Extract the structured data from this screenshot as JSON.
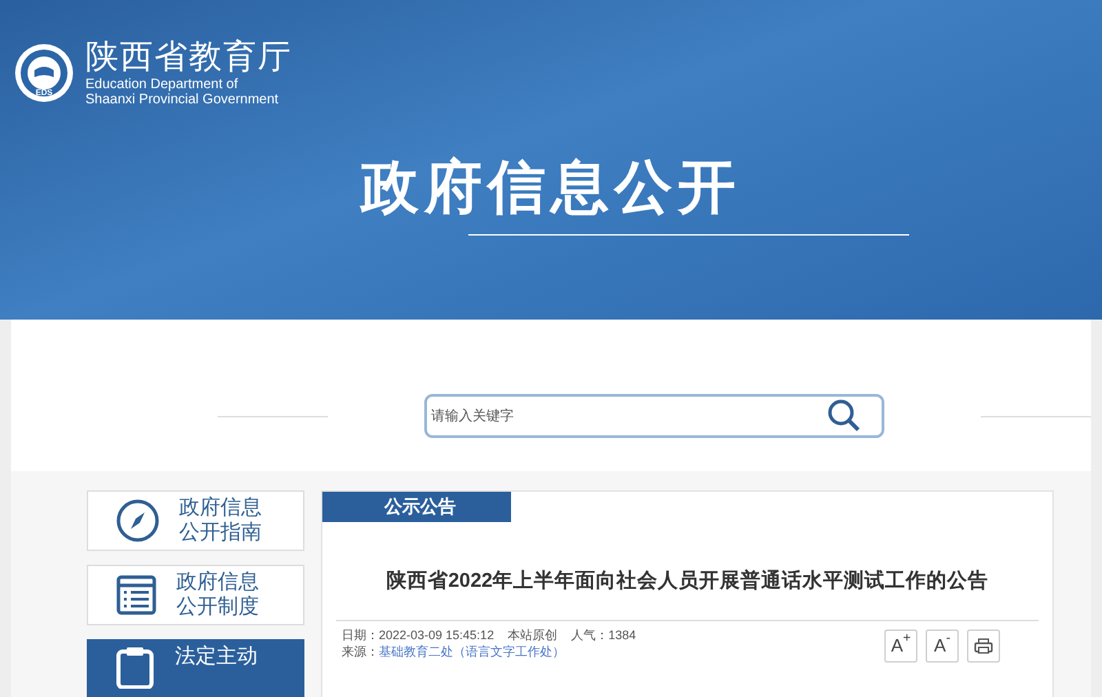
{
  "header": {
    "logo_mark": "EDS",
    "site_name": "陕西省教育厅",
    "site_name_en": [
      "Education Department of",
      "Shaanxi Provincial Government"
    ],
    "title": "政府信息公开"
  },
  "search": {
    "placeholder": "请输入关键字"
  },
  "sidebar": {
    "items": [
      {
        "kind": "compass",
        "label": "政府信息公开指南",
        "selected": false
      },
      {
        "kind": "list",
        "label": "政府信息公开制度",
        "selected": false
      },
      {
        "kind": "clipboard",
        "label": "法定主动",
        "selected": true
      }
    ]
  },
  "article": {
    "section_tab": "公示公告",
    "title": "陕西省2022年上半年面向社会人员开展普通话水平测试工作的公告",
    "meta": {
      "date": "日期：2022-03-09 15:45:12",
      "origin": "本站原创",
      "views": "人气：1384",
      "source_label": "来源：",
      "source_link": "基础教育二处（语言文字工作处）"
    },
    "tools": [
      {
        "kind": "text",
        "label": "A$^{+}$"
      },
      {
        "kind": "text",
        "label": "A$^{-}$"
      },
      {
        "kind": "print"
      }
    ]
  }
}
